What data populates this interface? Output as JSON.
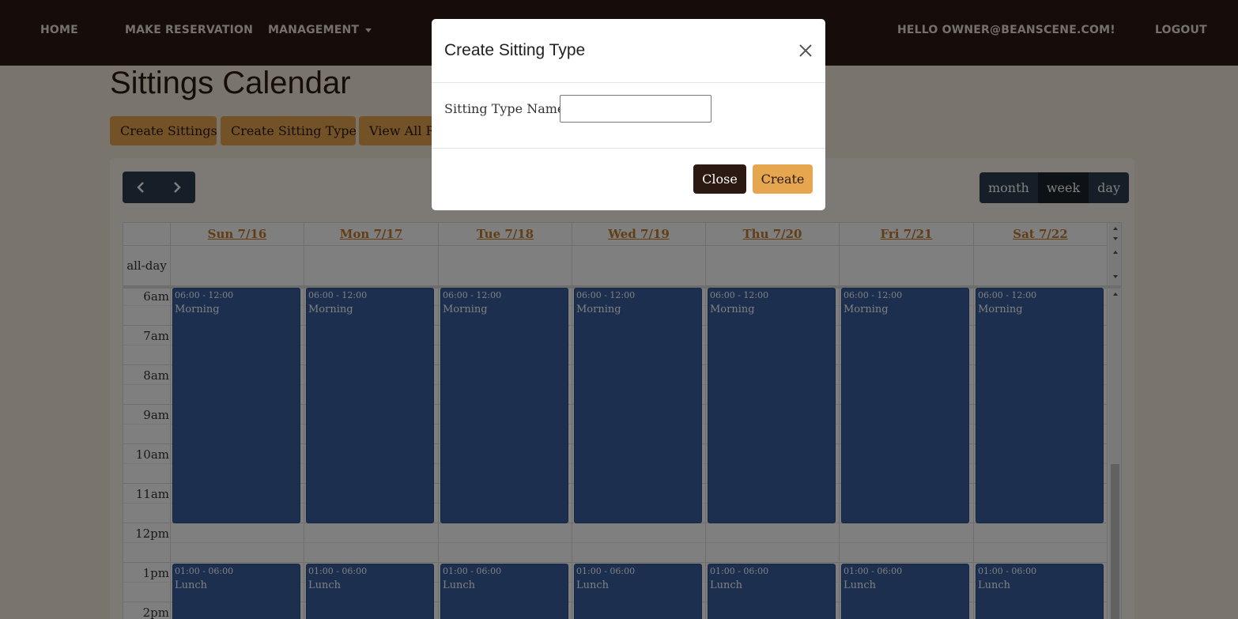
{
  "nav": {
    "home": "HOME",
    "make_reservation": "MAKE RESERVATION",
    "management": "MANAGEMENT",
    "greeting": "HELLO OWNER@BEANSCENE.COM!",
    "logout": "LOGOUT"
  },
  "page": {
    "title": "Sittings Calendar",
    "buttons": [
      "Create Sittings",
      "Create Sitting Type",
      "View All Reservations"
    ]
  },
  "calendar": {
    "views": [
      "month",
      "week",
      "day"
    ],
    "active_view": "week",
    "all_day_label": "all-day",
    "days": [
      "Sun 7/16",
      "Mon 7/17",
      "Tue 7/18",
      "Wed 7/19",
      "Thu 7/20",
      "Fri 7/21",
      "Sat 7/22"
    ],
    "time_labels": [
      "6am",
      "7am",
      "8am",
      "9am",
      "10am",
      "11am",
      "12pm",
      "1pm",
      "2pm"
    ],
    "events": [
      {
        "time": "06:00 - 12:00",
        "title": "Morning"
      },
      {
        "time": "01:00 - 06:00",
        "title": "Lunch"
      }
    ],
    "colors": {
      "event": "#3a5f9f",
      "day_header": "#c67d2a",
      "button_group": "#2c3e50"
    }
  },
  "modal": {
    "title": "Create Sitting Type",
    "field_label": "Sitting Type Name:",
    "field_value": "",
    "close_label": "Close",
    "create_label": "Create"
  },
  "colors": {
    "navbar": "#2c1912",
    "accent": "#e6a54f",
    "page_bg": "#f5ead9"
  }
}
